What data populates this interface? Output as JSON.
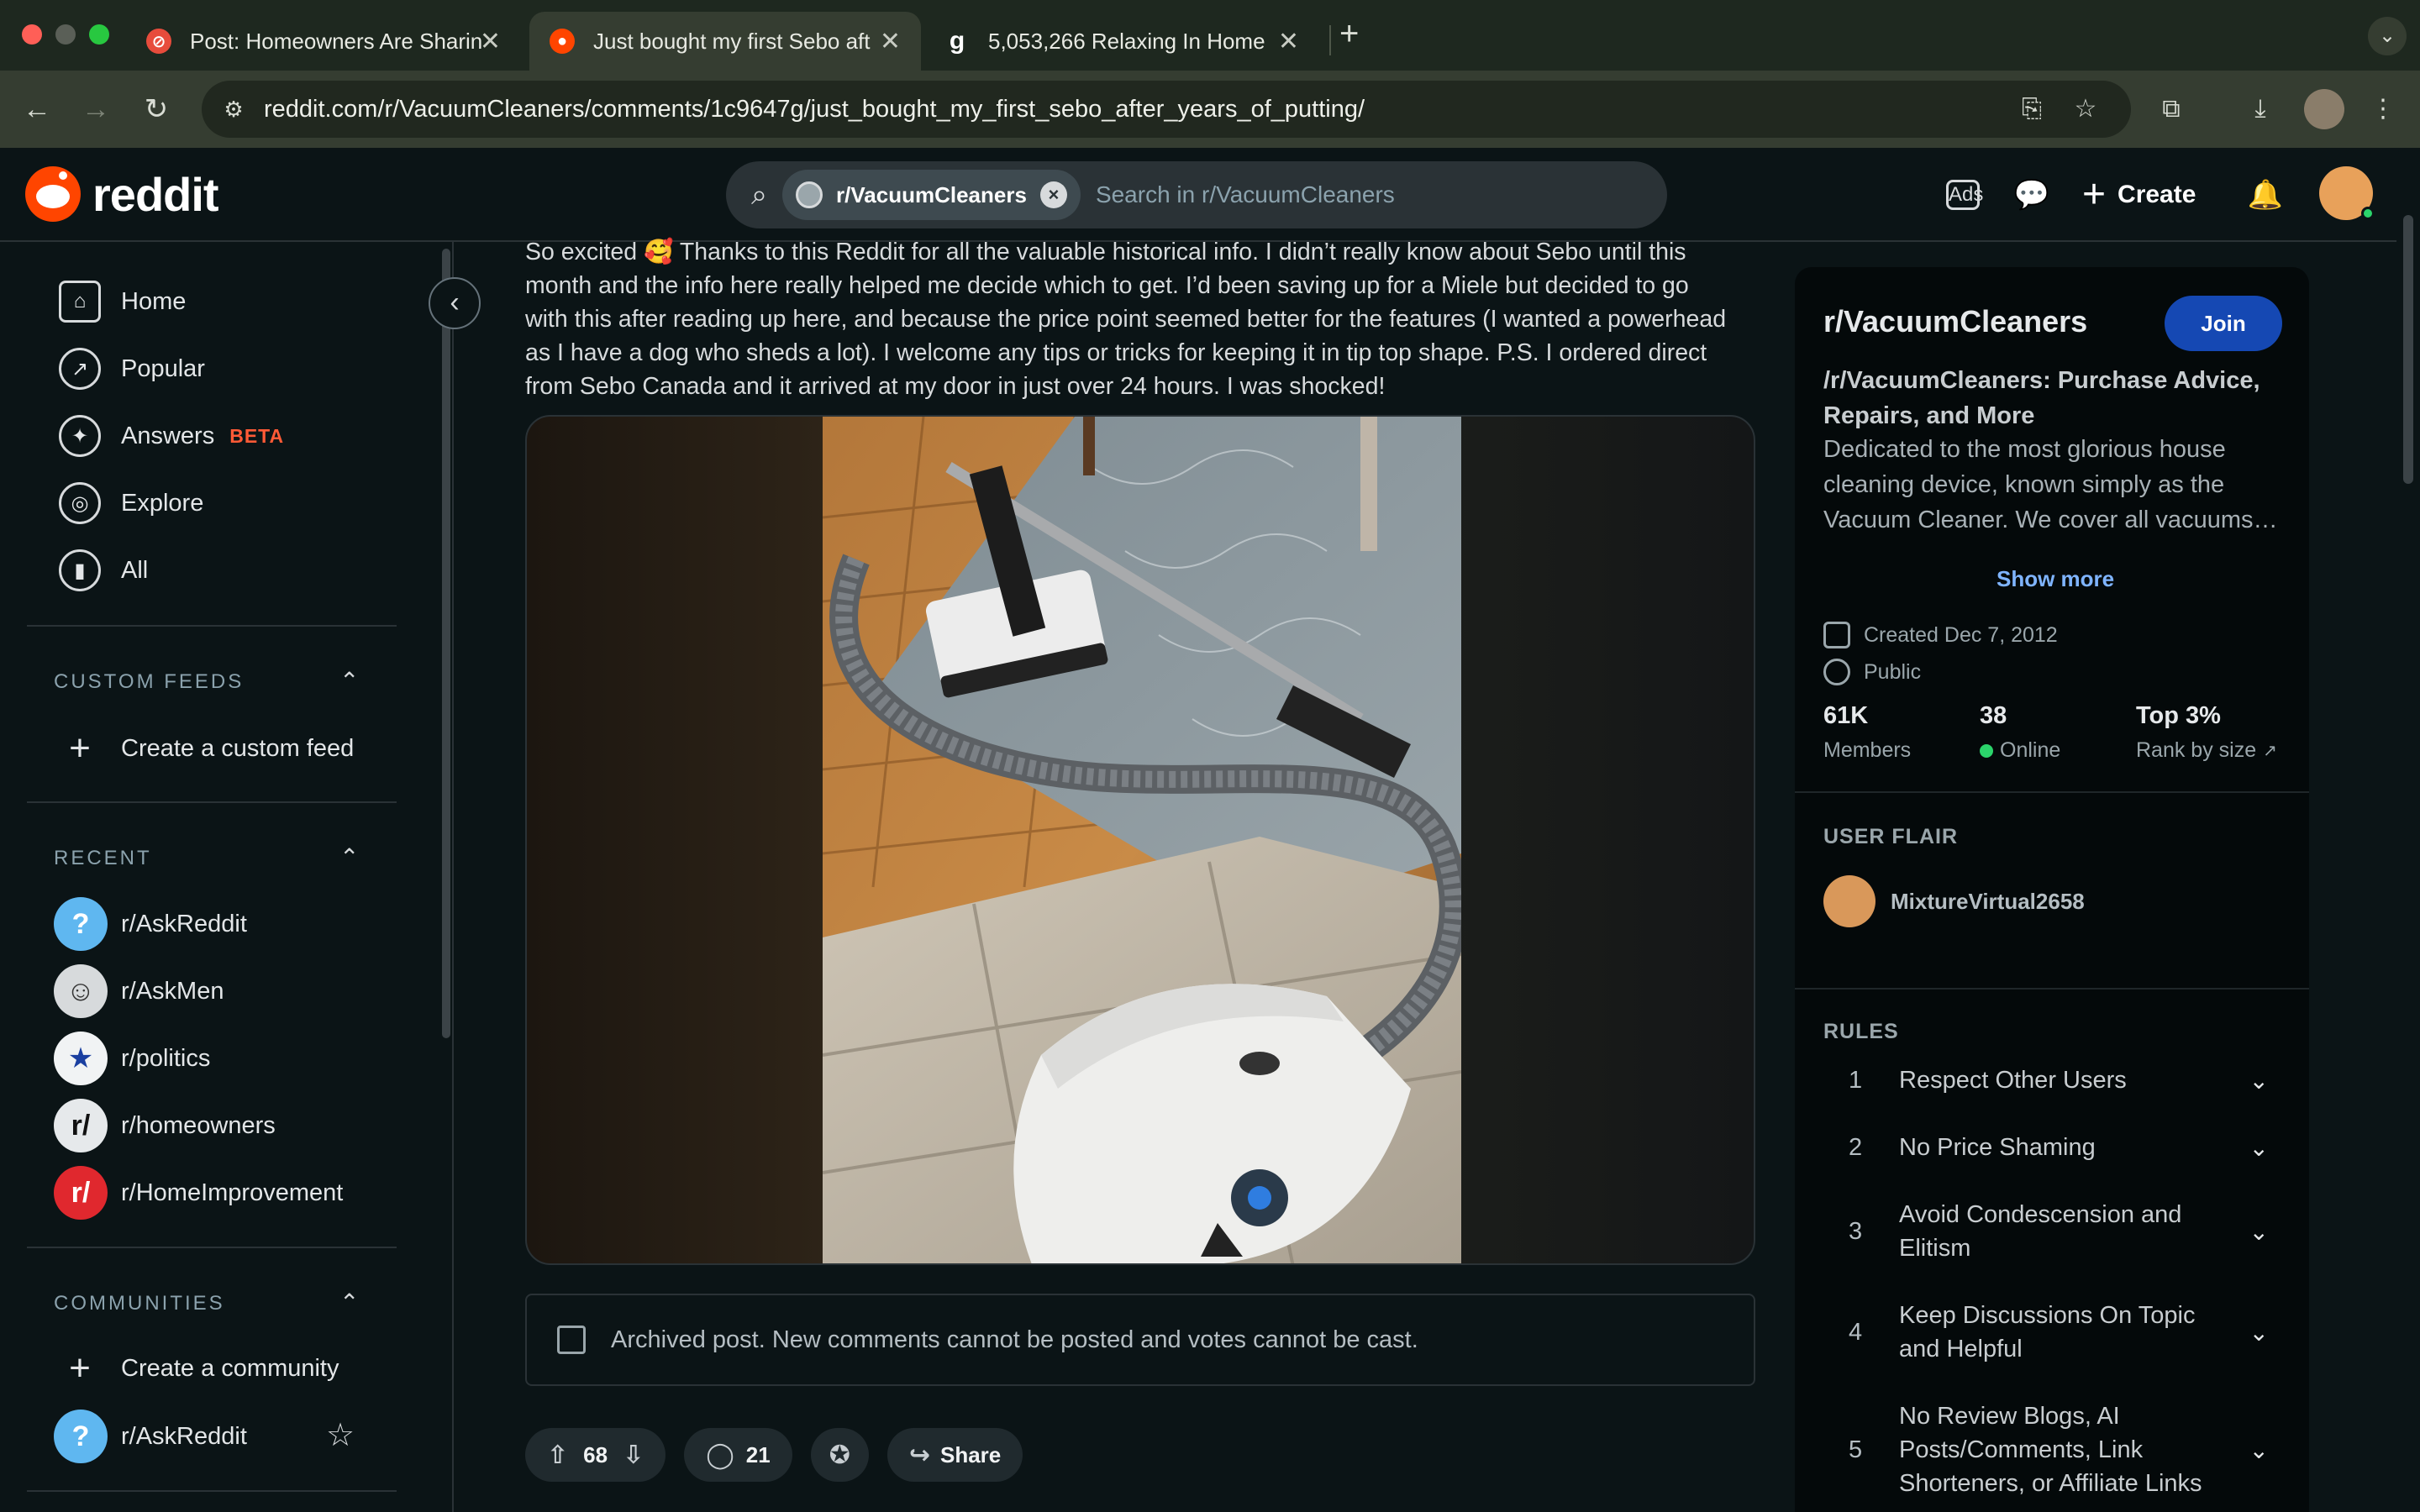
{
  "browser": {
    "tabs": [
      {
        "title": "Post: Homeowners Are Sharin",
        "active": false,
        "favicon": "no-entry-icon"
      },
      {
        "title": "Just bought my first Sebo aft",
        "active": true,
        "favicon": "reddit-icon"
      },
      {
        "title": "5,053,266 Relaxing In Home",
        "active": false,
        "favicon": "getty-g-icon"
      }
    ],
    "url": "reddit.com/r/VacuumCleaners/comments/1c9647g/just_bought_my_first_sebo_after_years_of_putting/"
  },
  "header": {
    "logo_text": "reddit",
    "search_chip": "r/VacuumCleaners",
    "search_placeholder": "Search in r/VacuumCleaners",
    "create_label": "Create"
  },
  "sidebar": {
    "nav": [
      {
        "label": "Home",
        "icon": "home-icon"
      },
      {
        "label": "Popular",
        "icon": "popular-icon"
      },
      {
        "label": "Answers",
        "icon": "answers-icon",
        "badge": "BETA"
      },
      {
        "label": "Explore",
        "icon": "explore-icon"
      },
      {
        "label": "All",
        "icon": "all-icon"
      }
    ],
    "custom_feeds_heading": "CUSTOM FEEDS",
    "create_custom_feed": "Create a custom feed",
    "recent_heading": "RECENT",
    "recent": [
      {
        "label": "r/AskReddit",
        "color": "#5fb7f0"
      },
      {
        "label": "r/AskMen",
        "color": "#d7dadc"
      },
      {
        "label": "r/politics",
        "color": "#f1f3f4"
      },
      {
        "label": "r/homeowners",
        "color": "#e6e9eb"
      },
      {
        "label": "r/HomeImprovement",
        "color": "#e0282e"
      }
    ],
    "communities_heading": "COMMUNITIES",
    "create_community": "Create a community",
    "communities": [
      {
        "label": "r/AskReddit",
        "color": "#5fb7f0"
      }
    ]
  },
  "post": {
    "body": "So excited 🥰 Thanks to this Reddit for all the valuable historical info. I didn’t really know about Sebo until this month and the info here really helped me decide which to get. I’d been saving up for a Miele but decided to go with this after reading up here, and because the price point seemed better for the features (I wanted a powerhead as I have a dog who sheds a lot). I welcome any tips or tricks for keeping it in tip top shape. P.S. I ordered direct from Sebo Canada and it arrived at my door in just over 24 hours. I was shocked!",
    "archived_notice": "Archived post. New comments cannot be posted and votes cannot be cast.",
    "votes": "68",
    "comments": "21",
    "share_label": "Share"
  },
  "community": {
    "name": "r/VacuumCleaners",
    "join_label": "Join",
    "subtitle": "/r/VacuumCleaners: Purchase Advice, Repairs, and More",
    "description": "Dedicated to the most glorious house cleaning device, known simply as the Vacuum Cleaner. We cover all vacuums…",
    "show_more": "Show more",
    "created": "Created Dec 7, 2012",
    "visibility": "Public",
    "members_value": "61K",
    "members_label": "Members",
    "online_value": "38",
    "online_label": "Online",
    "rank_value": "Top 3%",
    "rank_label": "Rank by size",
    "user_flair_heading": "USER FLAIR",
    "username": "MixtureVirtual2658",
    "rules_heading": "RULES",
    "rules": [
      {
        "num": "1",
        "text": "Respect Other Users"
      },
      {
        "num": "2",
        "text": "No Price Shaming"
      },
      {
        "num": "3",
        "text": "Avoid Condescension and Elitism"
      },
      {
        "num": "4",
        "text": "Keep Discussions On Topic and Helpful"
      },
      {
        "num": "5",
        "text": "No Review Blogs, AI Posts/Comments, Link Shorteners, or Affiliate Links"
      }
    ]
  },
  "colors": {
    "reddit_orange": "#ff4500",
    "join_blue": "#1548b3",
    "online_green": "#2bd46b",
    "beta_orange": "#ff5a36"
  }
}
